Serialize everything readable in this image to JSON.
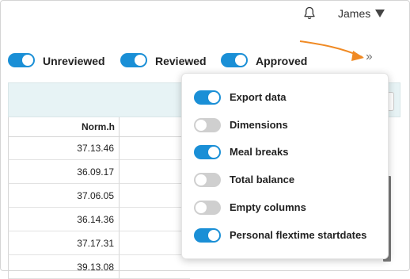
{
  "header": {
    "notifications_icon": "bell-icon",
    "user_name": "James",
    "user_menu_icon": "caret-down-icon"
  },
  "filters": [
    {
      "label": "Unreviewed",
      "on": true
    },
    {
      "label": "Reviewed",
      "on": true
    },
    {
      "label": "Approved",
      "on": true
    }
  ],
  "more_button_icon": "double-chevron-right-icon",
  "annotation_arrow_color": "#f08a24",
  "accent_color": "#1a8fd6",
  "table": {
    "column_header": "Norm.h",
    "rows": [
      "37.13.46",
      "36.09.17",
      "37.06.05",
      "36.14.36",
      "37.17.31",
      "39.13.08"
    ]
  },
  "menu": {
    "options": [
      {
        "label": "Export data",
        "on": true
      },
      {
        "label": "Dimensions",
        "on": false
      },
      {
        "label": "Meal breaks",
        "on": true
      },
      {
        "label": "Total balance",
        "on": false
      },
      {
        "label": "Empty columns",
        "on": false
      },
      {
        "label": "Personal flextime startdates",
        "on": true
      }
    ]
  }
}
